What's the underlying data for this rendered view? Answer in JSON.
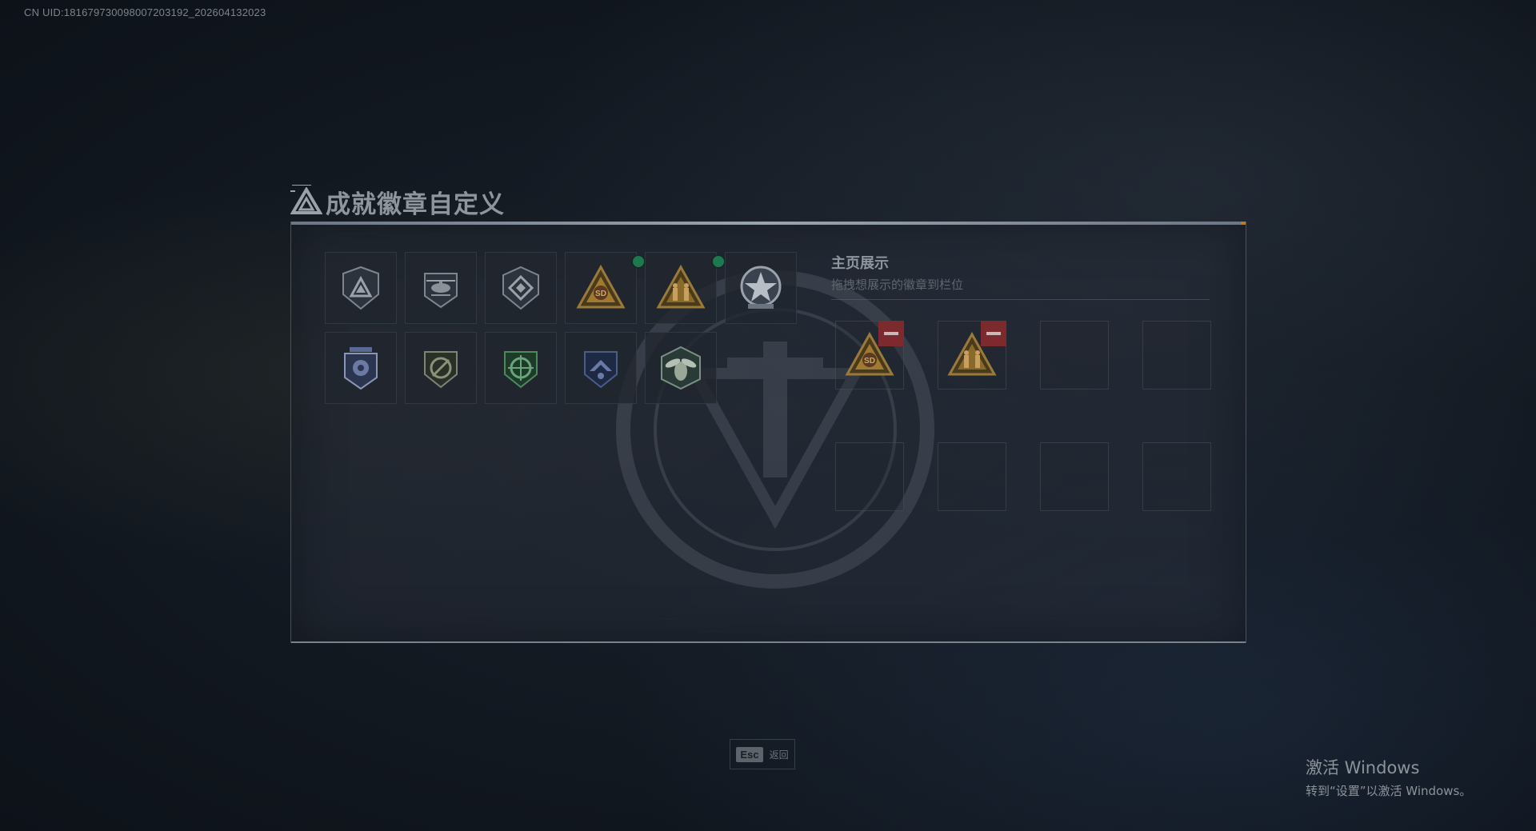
{
  "uid_text": "CN UID:18167973009800720319​2_202604132023",
  "page": {
    "title": "成就徽章自定义"
  },
  "badges": [
    {
      "icon": "triangle-shield-badge-icon",
      "new": false
    },
    {
      "icon": "helicopter-badge-icon",
      "new": false
    },
    {
      "icon": "diamond-emblem-badge-icon",
      "new": false
    },
    {
      "icon": "sd-warning-triangle-badge-icon",
      "new": true
    },
    {
      "icon": "soldiers-triangle-badge-icon",
      "new": true
    },
    {
      "icon": "star-wreath-badge-icon",
      "new": false
    },
    {
      "icon": "police-shield-badge-icon",
      "new": false
    },
    {
      "icon": "no-gun-shield-badge-icon",
      "new": false
    },
    {
      "icon": "green-target-shield-badge-icon",
      "new": false
    },
    {
      "icon": "blue-eagle-shield-badge-icon",
      "new": false
    },
    {
      "icon": "wasp-hexagon-badge-icon",
      "new": false
    }
  ],
  "display": {
    "title": "主页展示",
    "subtitle": "拖拽想展示的徽章到栏位",
    "slots": [
      {
        "badge": "sd-warning-triangle-badge-icon"
      },
      {
        "badge": "soldiers-triangle-badge-icon"
      },
      {
        "badge": null
      },
      {
        "badge": null
      },
      {
        "badge": null
      },
      {
        "badge": null
      },
      {
        "badge": null
      },
      {
        "badge": null
      }
    ]
  },
  "footer": {
    "esc_key": "Esc",
    "esc_label": "返回"
  },
  "windows": {
    "title": "激活 Windows",
    "subtitle": "转到“设置”以激活 Windows。"
  },
  "colors": {
    "new_dot": "#1d7a4f",
    "remove": "#7d2a2e",
    "accent_orange": "#b57b2e"
  }
}
